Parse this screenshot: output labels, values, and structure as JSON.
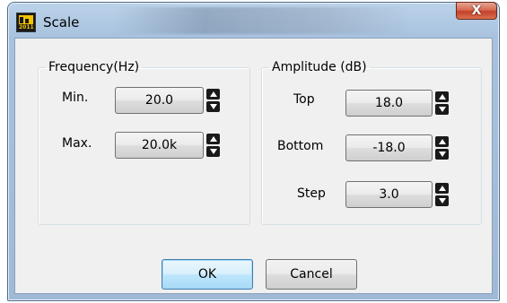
{
  "window": {
    "title": "Scale",
    "app_icon_text": "2011",
    "close_glyph": "X"
  },
  "frequency": {
    "legend": "Frequency(Hz)",
    "min_label": "Min.",
    "min_value": "20.0",
    "max_label": "Max.",
    "max_value": "20.0k"
  },
  "amplitude": {
    "legend": "Amplitude (dB)",
    "top_label": "Top",
    "top_value": "18.0",
    "bottom_label": "Bottom",
    "bottom_value": "-18.0",
    "step_label": "Step",
    "step_value": "3.0"
  },
  "buttons": {
    "ok": "OK",
    "cancel": "Cancel"
  },
  "colors": {
    "accent": "#3c7fb1",
    "close": "#c4412a",
    "icon_yellow": "#f2c400"
  },
  "icons": [
    "app-icon",
    "close-icon",
    "up-arrow-icon",
    "down-arrow-icon"
  ]
}
